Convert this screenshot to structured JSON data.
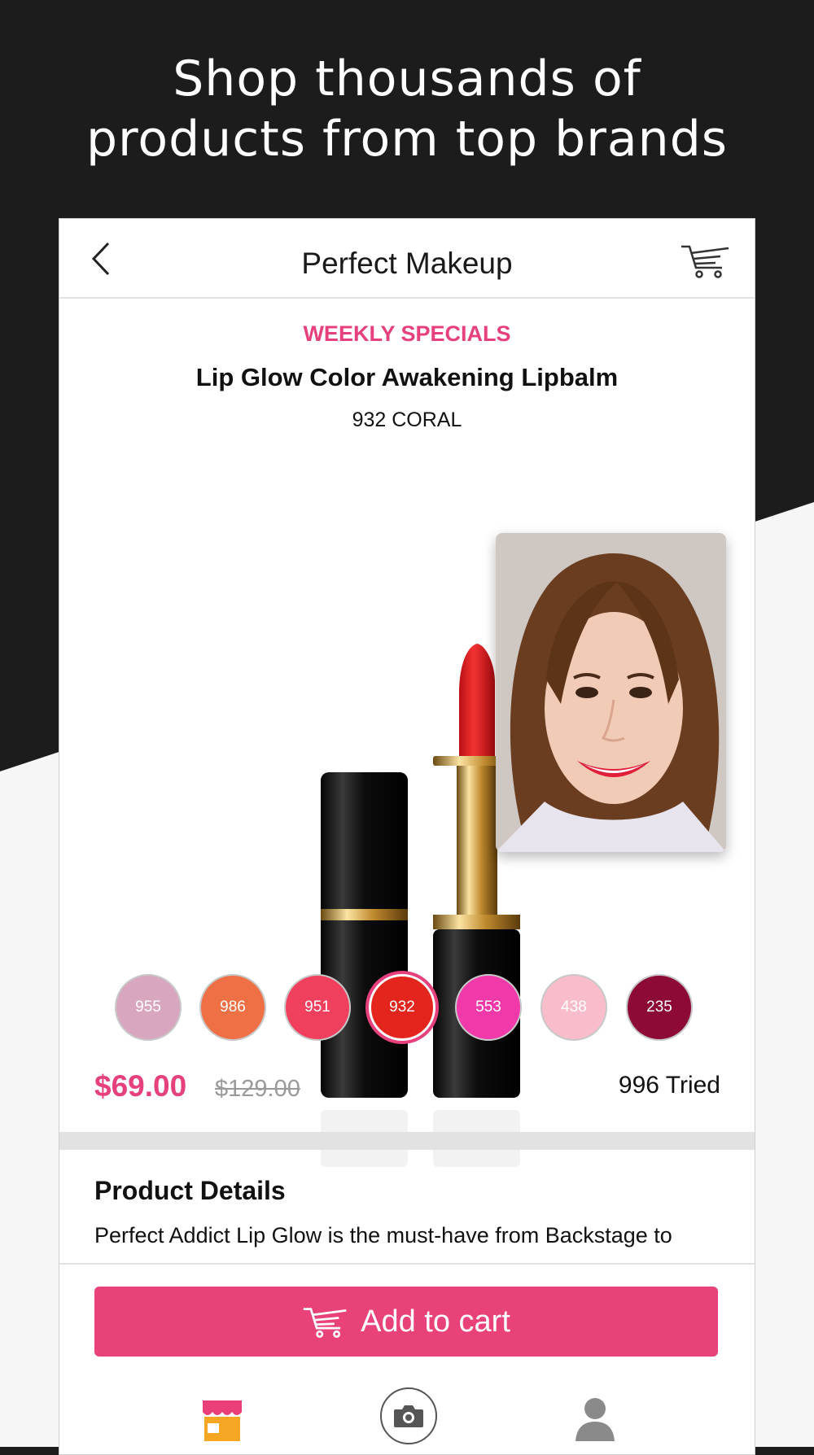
{
  "headline": {
    "line1": "Shop thousands of",
    "line2": "products from top brands"
  },
  "header": {
    "title": "Perfect Makeup",
    "back_icon": "chevron-left-icon",
    "cart_icon": "shopping-cart-icon"
  },
  "product": {
    "promo_label": "WEEKLY SPECIALS",
    "name": "Lip Glow Color Awakening Lipbalm",
    "shade": "932 CORAL"
  },
  "swatches": [
    {
      "code": "955",
      "color": "#d9a6bf",
      "selected": false
    },
    {
      "code": "986",
      "color": "#f07046",
      "selected": false
    },
    {
      "code": "951",
      "color": "#f0405d",
      "selected": false
    },
    {
      "code": "932",
      "color": "#e3251e",
      "selected": true
    },
    {
      "code": "553",
      "color": "#f239a9",
      "selected": false
    },
    {
      "code": "438",
      "color": "#f8bccb",
      "selected": false
    },
    {
      "code": "235",
      "color": "#8c0a35",
      "selected": false
    }
  ],
  "pricing": {
    "current": "$69.00",
    "original": "$129.00",
    "tried": "996 Tried"
  },
  "details": {
    "title": "Product Details",
    "text": "Perfect Addict Lip Glow is the must-have from Backstage to"
  },
  "cta": {
    "label": "Add to cart",
    "icon": "shopping-cart-icon"
  },
  "bottom_nav": [
    {
      "icon": "store-icon",
      "color": "#f5a623"
    },
    {
      "icon": "camera-icon"
    },
    {
      "icon": "profile-icon"
    }
  ],
  "colors": {
    "accent": "#e94278",
    "dark_bg": "#1c1c1c"
  }
}
